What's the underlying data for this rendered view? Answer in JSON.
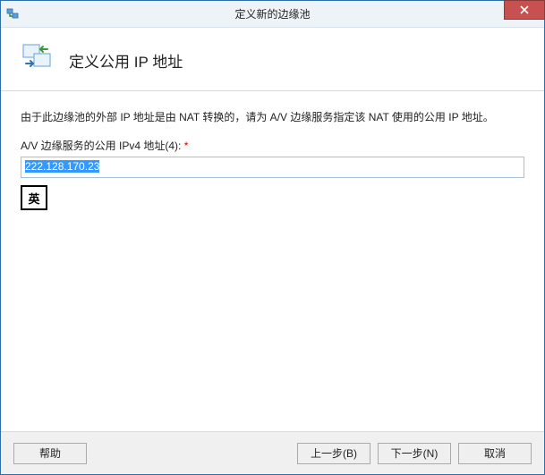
{
  "window": {
    "title": "定义新的边缘池"
  },
  "header": {
    "title": "定义公用 IP 地址"
  },
  "content": {
    "description": "由于此边缘池的外部 IP 地址是由 NAT 转换的，请为 A/V 边缘服务指定该 NAT 使用的公用 IP 地址。",
    "field_label": "A/V 边缘服务的公用 IPv4 地址(4):",
    "required_marker": "*",
    "ip_value": "222.128.170.23",
    "ime_indicator": "英"
  },
  "footer": {
    "help": "帮助",
    "back": "上一步(B)",
    "next": "下一步(N)",
    "cancel": "取消"
  }
}
